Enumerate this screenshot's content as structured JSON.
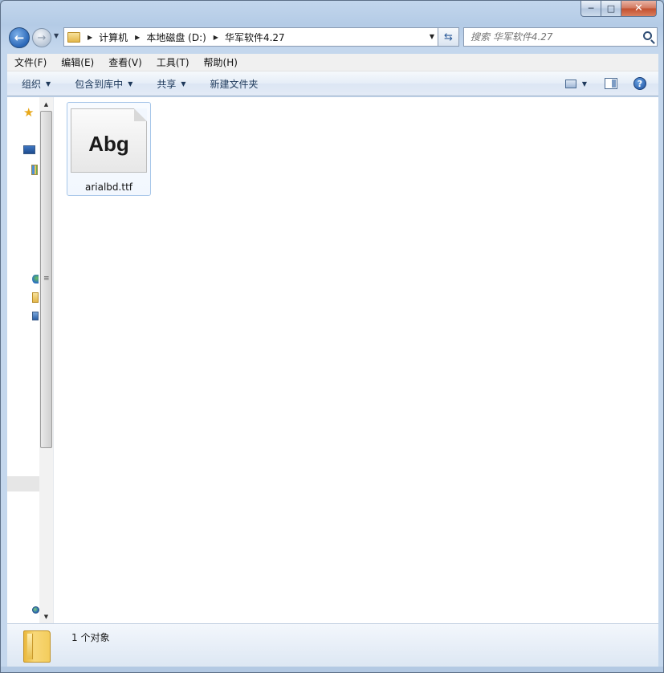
{
  "window": {
    "caption_buttons": {
      "minimize": "─",
      "maximize": "□",
      "close": "✕"
    }
  },
  "navigation": {
    "back_glyph": "←",
    "forward_glyph": "→",
    "breadcrumbs": [
      "计算机",
      "本地磁盘 (D:)",
      "华军软件4.27"
    ],
    "search_placeholder": "搜索 华军软件4.27"
  },
  "menubar": {
    "items": [
      "文件(F)",
      "编辑(E)",
      "查看(V)",
      "工具(T)",
      "帮助(H)"
    ]
  },
  "toolbar": {
    "organize": "组织",
    "include_in_library": "包含到库中",
    "share": "共享",
    "new_folder": "新建文件夹",
    "help_glyph": "?"
  },
  "navpane": {
    "icons": [
      "star-icon",
      "monitor-icon",
      "libraries-icon",
      "network-icon",
      "folder-icon",
      "computer-icon",
      "globe-icon"
    ]
  },
  "files": [
    {
      "name": "arialbd.ttf",
      "preview": "Abg"
    }
  ],
  "status": {
    "item_count": "1 个对象"
  }
}
